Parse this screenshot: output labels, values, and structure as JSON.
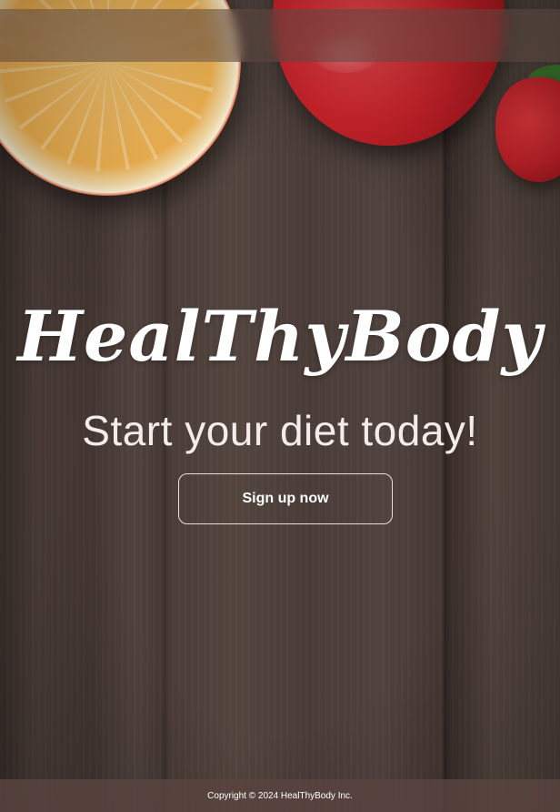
{
  "brand": {
    "name": "HealThyBody"
  },
  "hero": {
    "tagline": "Start your diet today!",
    "cta_label": "Sign up now"
  },
  "footer": {
    "copyright": "Copyright © 2024 HealThyBody Inc."
  },
  "colors": {
    "background_wood": "#4a3b36",
    "text": "#ffffff",
    "button_border": "#e9dfdc",
    "footer_bg": "#58443f"
  }
}
